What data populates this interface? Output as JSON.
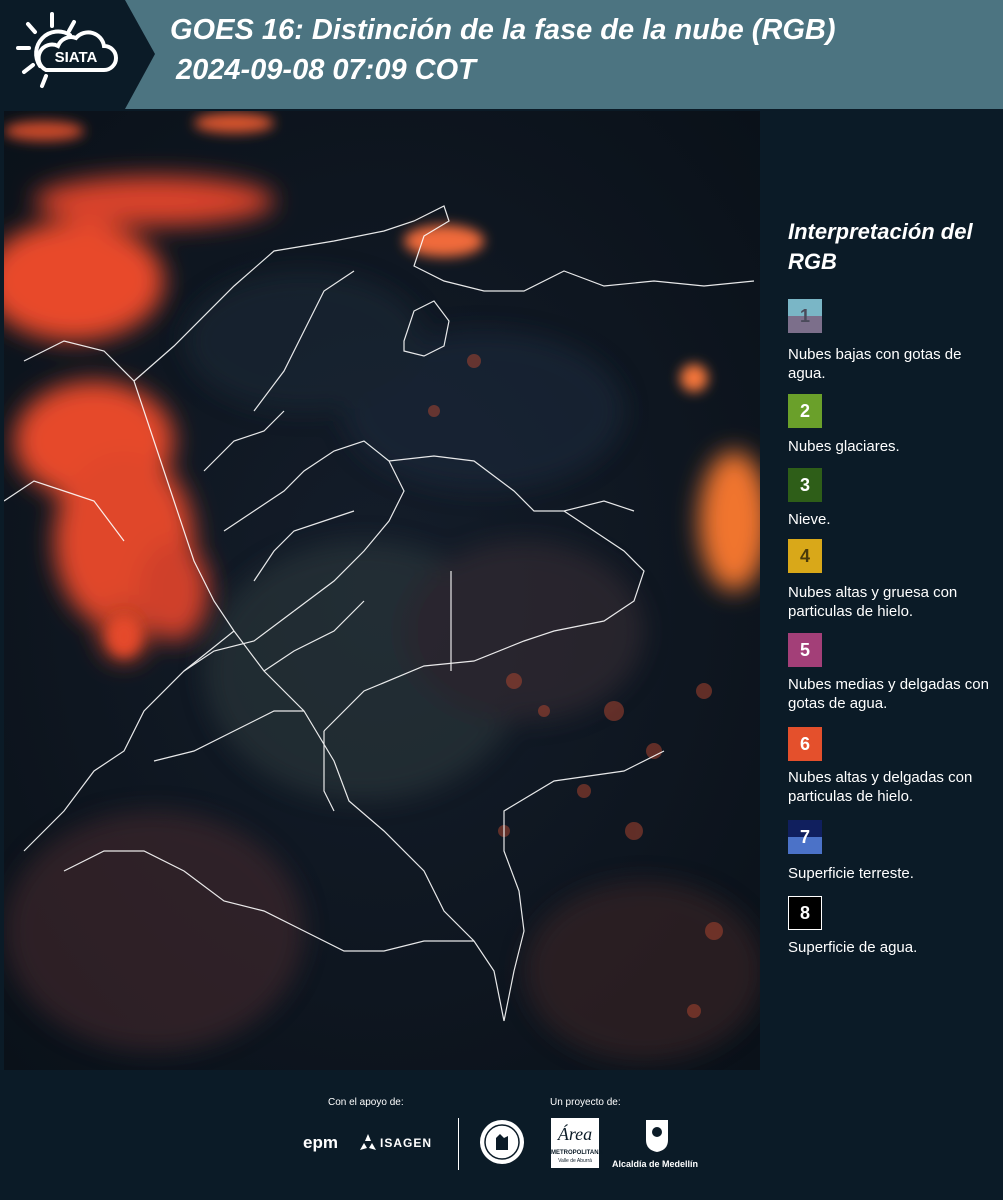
{
  "header": {
    "logo_text": "SIATA",
    "title": "GOES 16: Distinción de la fase de la nube (RGB)",
    "subtitle": "2024-09-08 07:09 COT"
  },
  "map": {
    "icon": "satellite-map-image"
  },
  "legend": {
    "title": "Interpretación del RGB",
    "items": [
      {
        "number": "1",
        "label": "Nubes bajas con gotas de agua.",
        "colors": [
          "#7ab6c6",
          "#7c6f8b"
        ]
      },
      {
        "number": "2",
        "label": "Nubes glaciares.",
        "colors": [
          "#6aa02a"
        ]
      },
      {
        "number": "3",
        "label": "Nieve.",
        "colors": [
          "#2e5e18"
        ]
      },
      {
        "number": "4",
        "label": "Nubes altas y gruesa con particulas de hielo.",
        "colors": [
          "#d9a819"
        ]
      },
      {
        "number": "5",
        "label": "Nubes medias y delgadas con gotas de agua.",
        "colors": [
          "#a33f78"
        ]
      },
      {
        "number": "6",
        "label": "Nubes altas y delgadas con particulas de hielo.",
        "colors": [
          "#e4502c"
        ]
      },
      {
        "number": "7",
        "label": "Superficie terreste.",
        "colors": [
          "#101f5e",
          "#4b72c8"
        ]
      },
      {
        "number": "8",
        "label": "Superficie de agua.",
        "colors": [
          "#000000"
        ]
      }
    ]
  },
  "footer": {
    "support_caption": "Con el apoyo de:",
    "project_caption": "Un proyecto de:",
    "logos": {
      "epm": "epm",
      "isagen": "ISAGEN",
      "metropolitana": "METROPOLITANA",
      "metropolitana_sub": "Valle de Aburrá",
      "alcaldia": "Alcaldía de Medellín"
    }
  }
}
